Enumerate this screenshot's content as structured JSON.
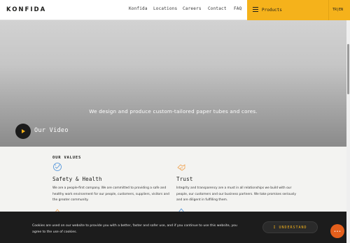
{
  "header": {
    "logo": "KONFIDA",
    "nav": [
      "Konfida",
      "Locations",
      "Careers",
      "Contact",
      "FAQ"
    ],
    "products_label": "Products",
    "lang": "TR|EN"
  },
  "hero": {
    "tagline": "We design and produce custom-tailored paper tubes and cores.",
    "video_label": "Our Video"
  },
  "values": {
    "title": "OUR VALUES",
    "items": [
      {
        "title": "Safety & Health",
        "text": "We are a people-first company. We are committed to providing a safe and healthy work environment for our people, customers, suppliers, visitors and the greater community."
      },
      {
        "title": "Trust",
        "text": "Integrity and transparency are a must in all relationships we build with our people, our customers and our business partners. We take promises seriously and are diligent in fulfilling them."
      }
    ]
  },
  "cookie": {
    "text": "Cookies are used on our website to provide you with a better, faster and safer use, and if you continue to use this website, you agree to the use of cookies.",
    "button": "I UNDERSTAND"
  },
  "colors": {
    "accent": "#f5b21b",
    "dark": "#1c1c1c",
    "chat": "#e45f1c",
    "icon": "#4a90d9",
    "icon2": "#f0a04b"
  },
  "icons": [
    "menu-icon",
    "play-icon",
    "safety-icon",
    "trust-icon",
    "chat-icon"
  ]
}
